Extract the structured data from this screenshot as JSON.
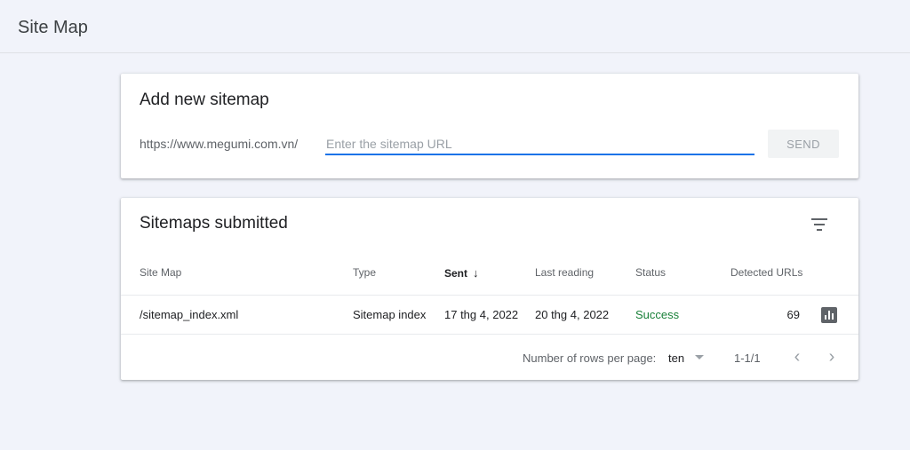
{
  "page": {
    "title": "Site Map"
  },
  "add_sitemap": {
    "title": "Add new sitemap",
    "url_prefix": "https://www.megumi.com.vn/",
    "input_value": "",
    "input_placeholder": "Enter the sitemap URL",
    "send_label": "SEND"
  },
  "submitted": {
    "title": "Sitemaps submitted",
    "filter_icon": "filter-icon",
    "columns": {
      "site_map": "Site Map",
      "type": "Type",
      "sent": "Sent",
      "last_reading": "Last reading",
      "status": "Status",
      "detected_urls": "Detected URLs"
    },
    "sort_icon": "arrow-down-icon",
    "rows": [
      {
        "site_map": "/sitemap_index.xml",
        "type": "Sitemap index",
        "sent": "17 thg 4, 2022",
        "last_reading": "20 thg 4, 2022",
        "status": "Success",
        "detected_urls": "69",
        "action_icon": "bar-chart-icon"
      }
    ],
    "footer": {
      "rows_per_page_label": "Number of rows per page:",
      "rows_per_page_value": "ten",
      "range": "1-1/1"
    }
  },
  "colors": {
    "background": "#f1f3fa",
    "accent": "#1a73e8",
    "success": "#188038",
    "muted": "#5f6368"
  }
}
